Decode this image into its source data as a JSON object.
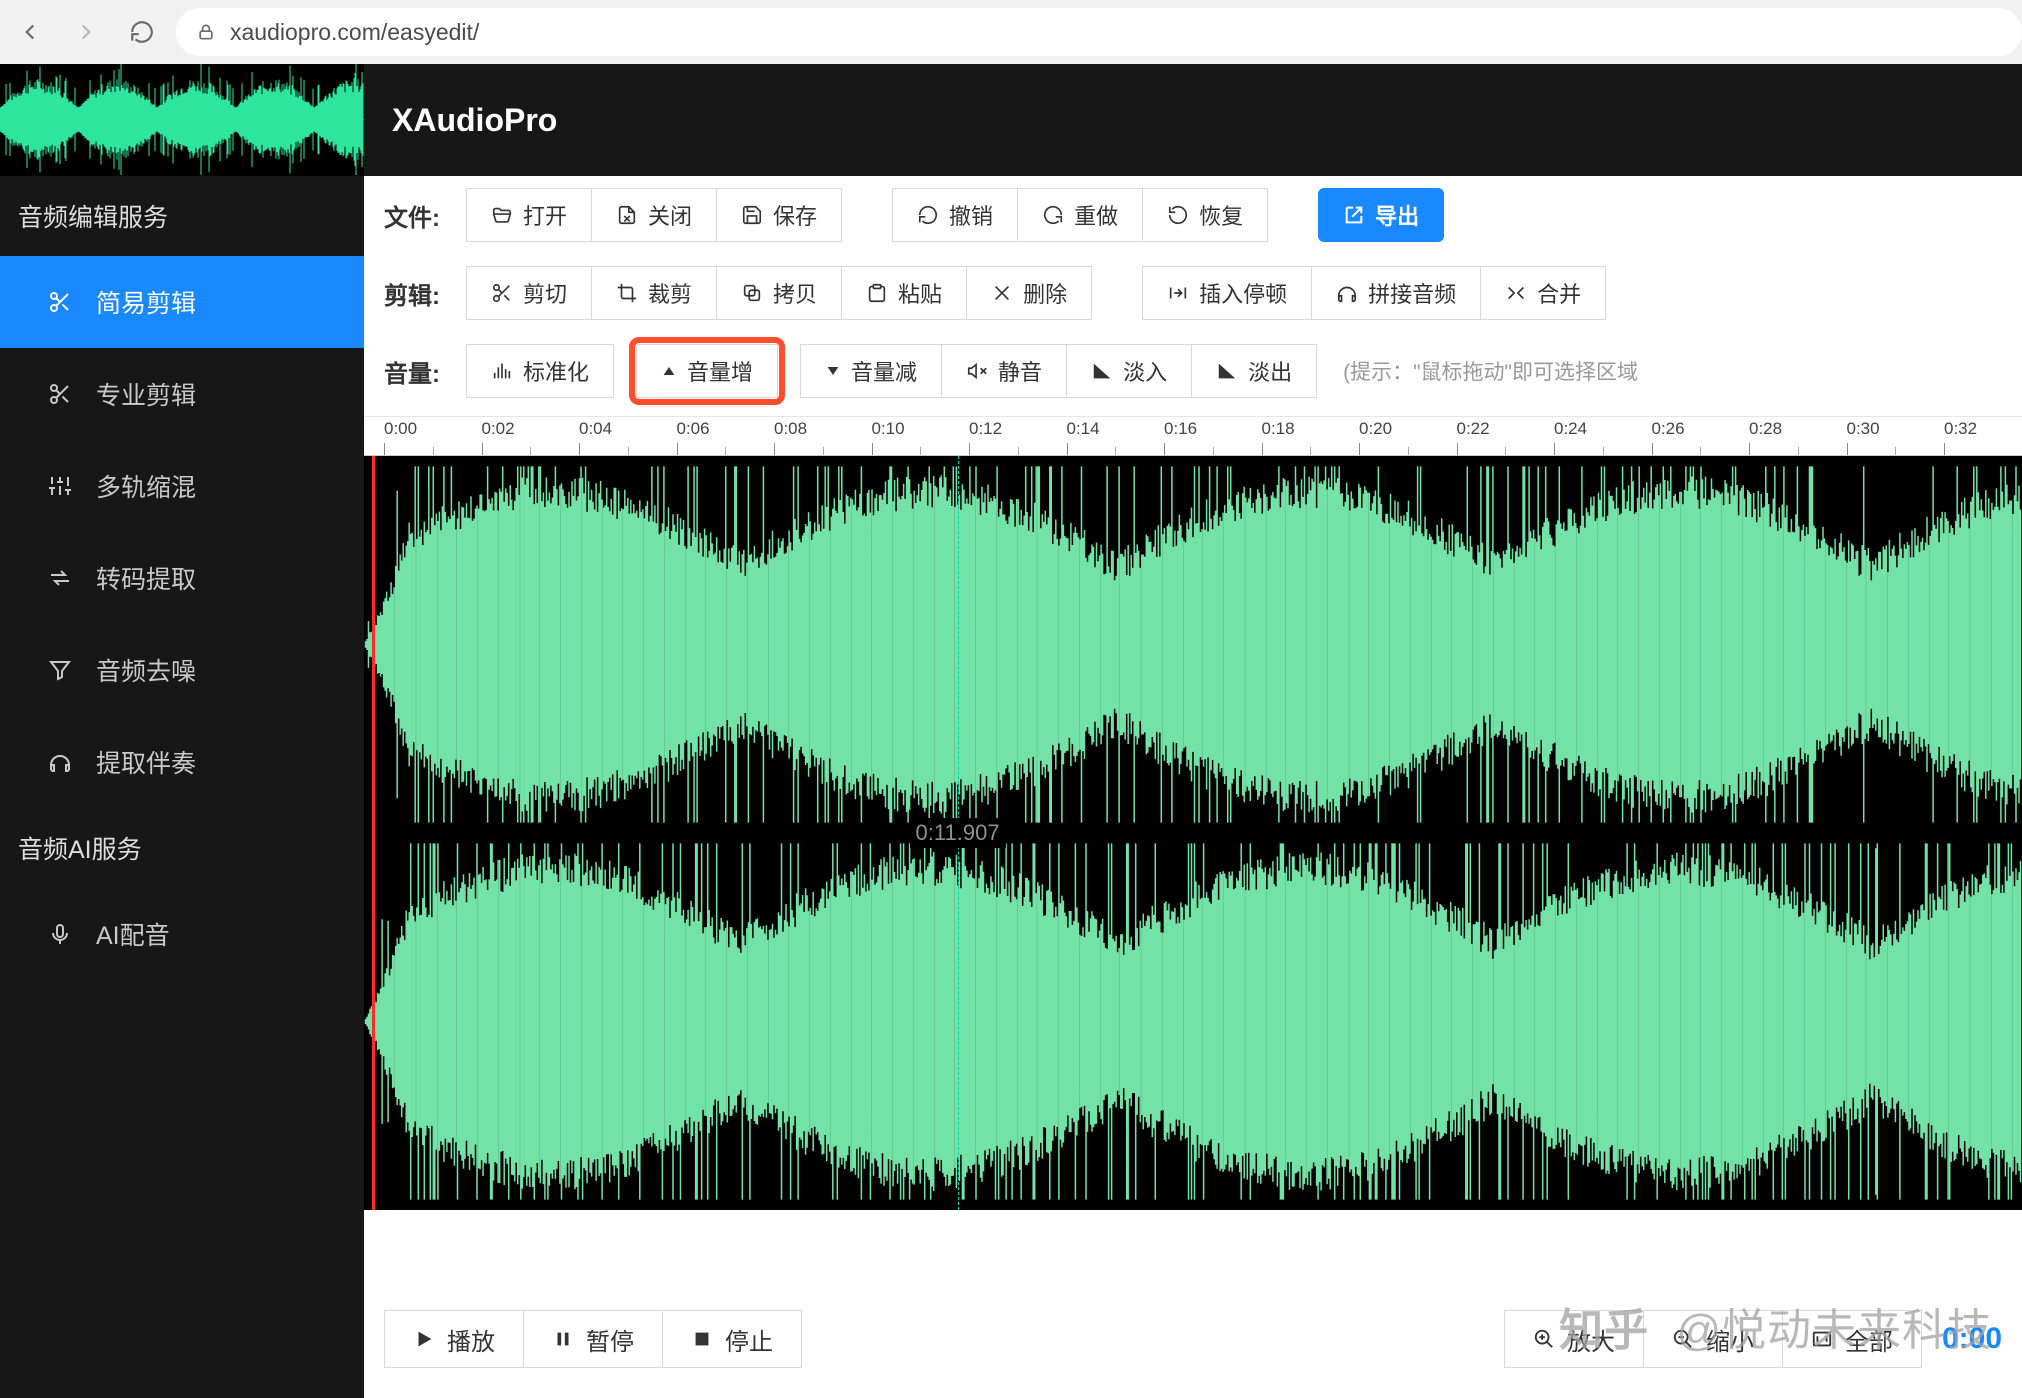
{
  "browser": {
    "url": "xaudiopro.com/easyedit/"
  },
  "app": {
    "title": "XAudioPro"
  },
  "sidebar": {
    "section1_title": "音频编辑服务",
    "section2_title": "音频AI服务",
    "items": [
      {
        "label": "简易剪辑",
        "active": true
      },
      {
        "label": "专业剪辑",
        "active": false
      },
      {
        "label": "多轨缩混",
        "active": false
      },
      {
        "label": "转码提取",
        "active": false
      },
      {
        "label": "音频去噪",
        "active": false
      },
      {
        "label": "提取伴奏",
        "active": false
      }
    ],
    "ai_items": [
      {
        "label": "AI配音",
        "active": false
      }
    ]
  },
  "toolbars": {
    "file": {
      "label": "文件:",
      "open": "打开",
      "close": "关闭",
      "save": "保存",
      "undo": "撤销",
      "redo": "重做",
      "restore": "恢复",
      "export": "导出"
    },
    "edit": {
      "label": "剪辑:",
      "cut": "剪切",
      "crop": "裁剪",
      "copy": "拷贝",
      "paste": "粘贴",
      "delete": "删除",
      "insert_silence": "插入停顿",
      "concat": "拼接音频",
      "merge": "合并"
    },
    "volume": {
      "label": "音量:",
      "normalize": "标准化",
      "volup": "音量增",
      "voldown": "音量减",
      "mute": "静音",
      "fadein": "淡入",
      "fadeout": "淡出",
      "hint": "(提示：\"鼠标拖动\"即可选择区域"
    }
  },
  "ruler": {
    "labels": [
      "0:00",
      "0:02",
      "0:04",
      "0:06",
      "0:08",
      "0:10",
      "0:12",
      "0:14",
      "0:16",
      "0:18",
      "0:20",
      "0:22",
      "0:24",
      "0:26",
      "0:28",
      "0:30",
      "0:32"
    ]
  },
  "playhead": {
    "time": "0:11.907",
    "x_ratio": 0.358
  },
  "end_time": "0:00",
  "playback": {
    "play": "播放",
    "pause": "暂停",
    "stop": "停止",
    "zoomin": "放大",
    "zoomout": "缩小",
    "all": "全部"
  },
  "watermark": {
    "brand": "知乎",
    "author": "@悦动未来科技"
  }
}
